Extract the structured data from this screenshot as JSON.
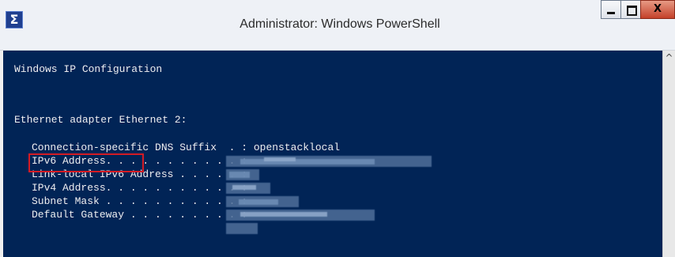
{
  "window": {
    "title": "Administrator: Windows PowerShell",
    "close_label": "X",
    "app_icon": "powershell-icon",
    "scroll_up_glyph": "^"
  },
  "colors": {
    "console_bg": "#012456",
    "console_text": "#eeedf0",
    "highlight": "#d41b24"
  },
  "console": {
    "lines": [
      "Windows IP Configuration",
      "Ethernet adapter Ethernet 2:",
      "Connection-specific DNS Suffix  . : openstacklocal",
      "IPv6 Address. . . . . . . . . . . :",
      "Link-local IPv6 Address . . . . . :",
      "IPv4 Address. . . . . . . . . . . :",
      "Subnet Mask . . . . . . . . . . . :",
      "Default Gateway . . . . . . . . . :"
    ]
  }
}
